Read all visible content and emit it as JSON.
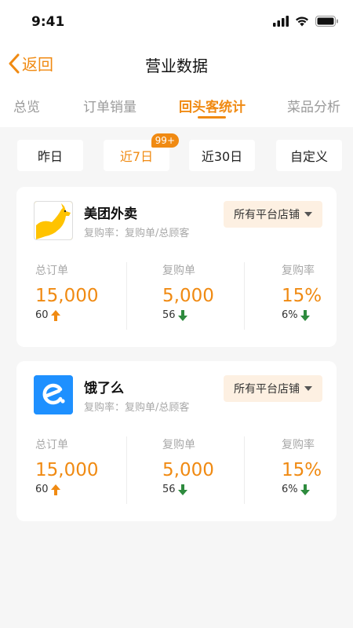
{
  "status": {
    "time": "9:41"
  },
  "nav": {
    "back_label": "返回",
    "title": "营业数据"
  },
  "tabs": [
    {
      "label": "总览"
    },
    {
      "label": "订单销量"
    },
    {
      "label": "回头客统计"
    },
    {
      "label": "菜品分析"
    }
  ],
  "filters": [
    {
      "label": "昨日"
    },
    {
      "label": "近7日",
      "badge": "99+"
    },
    {
      "label": "近30日"
    },
    {
      "label": "自定义"
    }
  ],
  "colors": {
    "accent": "#f08a12",
    "up": "#f08a12",
    "down": "#2e8b3e",
    "meituan": "#ffc300",
    "eleme": "#1e90ff"
  },
  "cards": [
    {
      "platform": "美团外卖",
      "logo_icon": "meituan-kangaroo-icon",
      "formula": "复购率：复购单/总顾客",
      "store_select": "所有平台店铺",
      "metrics": [
        {
          "label": "总订单",
          "value": "15,000",
          "change": "60",
          "trend": "up"
        },
        {
          "label": "复购单",
          "value": "5,000",
          "change": "56",
          "trend": "down"
        },
        {
          "label": "复购率",
          "value": "15%",
          "change": "6%",
          "trend": "down"
        }
      ]
    },
    {
      "platform": "饿了么",
      "logo_icon": "eleme-icon",
      "formula": "复购率：复购单/总顾客",
      "store_select": "所有平台店铺",
      "metrics": [
        {
          "label": "总订单",
          "value": "15,000",
          "change": "60",
          "trend": "up"
        },
        {
          "label": "复购单",
          "value": "5,000",
          "change": "56",
          "trend": "down"
        },
        {
          "label": "复购率",
          "value": "15%",
          "change": "6%",
          "trend": "down"
        }
      ]
    }
  ]
}
